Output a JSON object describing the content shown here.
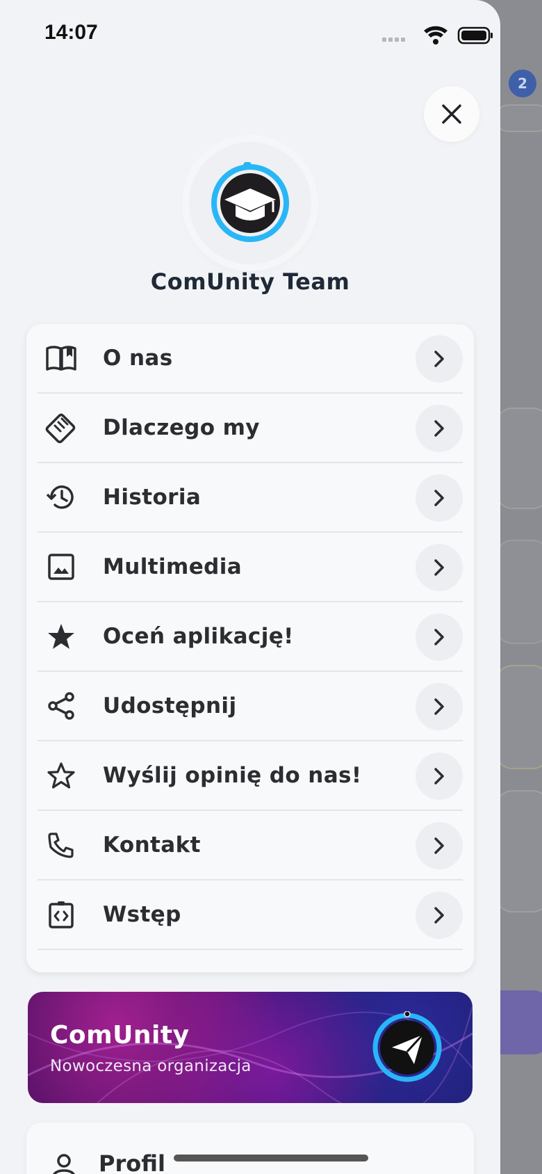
{
  "status_bar": {
    "time": "14:07"
  },
  "background": {
    "badge_count": "2"
  },
  "drawer": {
    "close_icon": "close-icon",
    "team_name": "ComUnity Team",
    "menu": [
      {
        "label": "O nas",
        "icon": "book-open-icon"
      },
      {
        "label": "Dlaczego my",
        "icon": "handshake-icon"
      },
      {
        "label": "Historia",
        "icon": "history-icon"
      },
      {
        "label": "Multimedia",
        "icon": "image-icon"
      },
      {
        "label": "Oceń aplikację!",
        "icon": "star-filled-icon"
      },
      {
        "label": "Udostępnij",
        "icon": "share-icon"
      },
      {
        "label": "Wyślij opinię do nas!",
        "icon": "star-outline-icon"
      },
      {
        "label": "Kontakt",
        "icon": "phone-icon"
      },
      {
        "label": "Wstęp",
        "icon": "code-clipboard-icon"
      }
    ],
    "banner": {
      "title": "ComUnity",
      "subtitle": "Nowoczesna organizacja",
      "icon": "paper-plane-icon"
    },
    "profile": {
      "label": "Profil",
      "icon": "person-icon"
    }
  },
  "colors": {
    "accent": "#29b6f6",
    "drawer_bg": "#f2f3f6",
    "text": "#2b2d31"
  }
}
